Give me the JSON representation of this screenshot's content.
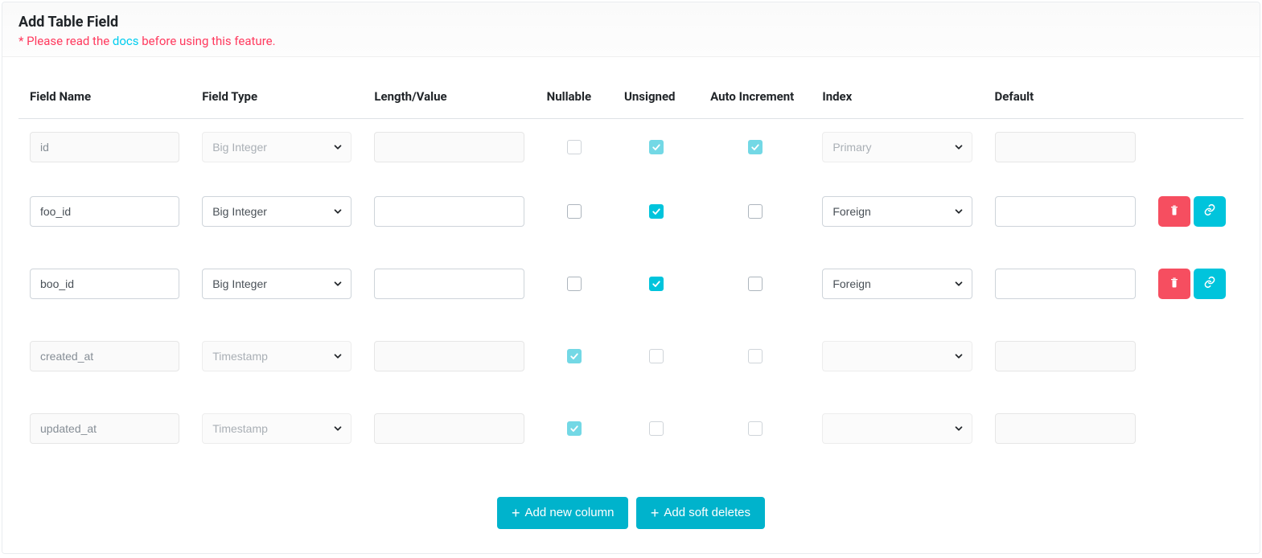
{
  "header": {
    "title": "Add Table Field",
    "notice_prefix": "* Please read the ",
    "notice_link": "docs",
    "notice_suffix": " before using this feature."
  },
  "columns": {
    "field_name": "Field Name",
    "field_type": "Field Type",
    "length_value": "Length/Value",
    "nullable": "Nullable",
    "unsigned": "Unsigned",
    "auto_increment": "Auto Increment",
    "index_": "Index",
    "default_": "Default"
  },
  "rows": [
    {
      "name": "id",
      "type": "Big Integer",
      "length": "",
      "nullable": false,
      "unsigned": true,
      "auto_increment": true,
      "index_": "Primary",
      "default_": "",
      "disabled": true,
      "actions": false
    },
    {
      "name": "foo_id",
      "type": "Big Integer",
      "length": "",
      "nullable": false,
      "unsigned": true,
      "auto_increment": false,
      "index_": "Foreign",
      "default_": "",
      "disabled": false,
      "actions": true
    },
    {
      "name": "boo_id",
      "type": "Big Integer",
      "length": "",
      "nullable": false,
      "unsigned": true,
      "auto_increment": false,
      "index_": "Foreign",
      "default_": "",
      "disabled": false,
      "actions": true
    },
    {
      "name": "created_at",
      "type": "Timestamp",
      "length": "",
      "nullable": true,
      "unsigned": false,
      "auto_increment": false,
      "index_": "",
      "default_": "",
      "disabled": true,
      "actions": false
    },
    {
      "name": "updated_at",
      "type": "Timestamp",
      "length": "",
      "nullable": true,
      "unsigned": false,
      "auto_increment": false,
      "index_": "",
      "default_": "",
      "disabled": true,
      "actions": false
    }
  ],
  "buttons": {
    "add_column": "Add new column",
    "add_soft_deletes": "Add soft deletes"
  }
}
